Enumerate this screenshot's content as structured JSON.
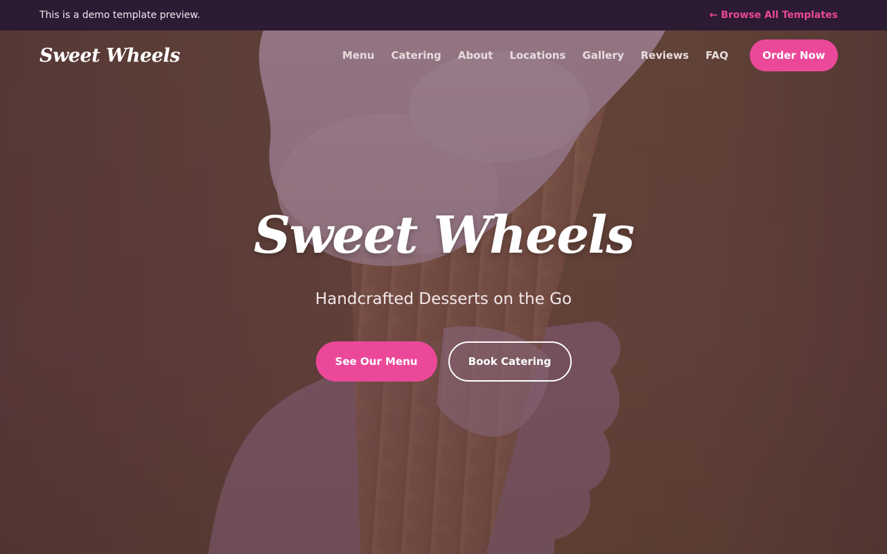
{
  "demo_bar": {
    "notice": "This is a demo template preview.",
    "browse_link": "← Browse All Templates"
  },
  "nav": {
    "logo": "Sweet Wheels",
    "links": [
      "Menu",
      "Catering",
      "About",
      "Locations",
      "Gallery",
      "Reviews",
      "FAQ"
    ],
    "order_button": "Order Now"
  },
  "hero": {
    "title": "Sweet Wheels",
    "subtitle": "Handcrafted Desserts on the Go",
    "primary_button": "See Our Menu",
    "secondary_button": "Book Catering"
  },
  "colors": {
    "accent": "#ec4899",
    "demo_bar_bg": "#2c1b32"
  }
}
